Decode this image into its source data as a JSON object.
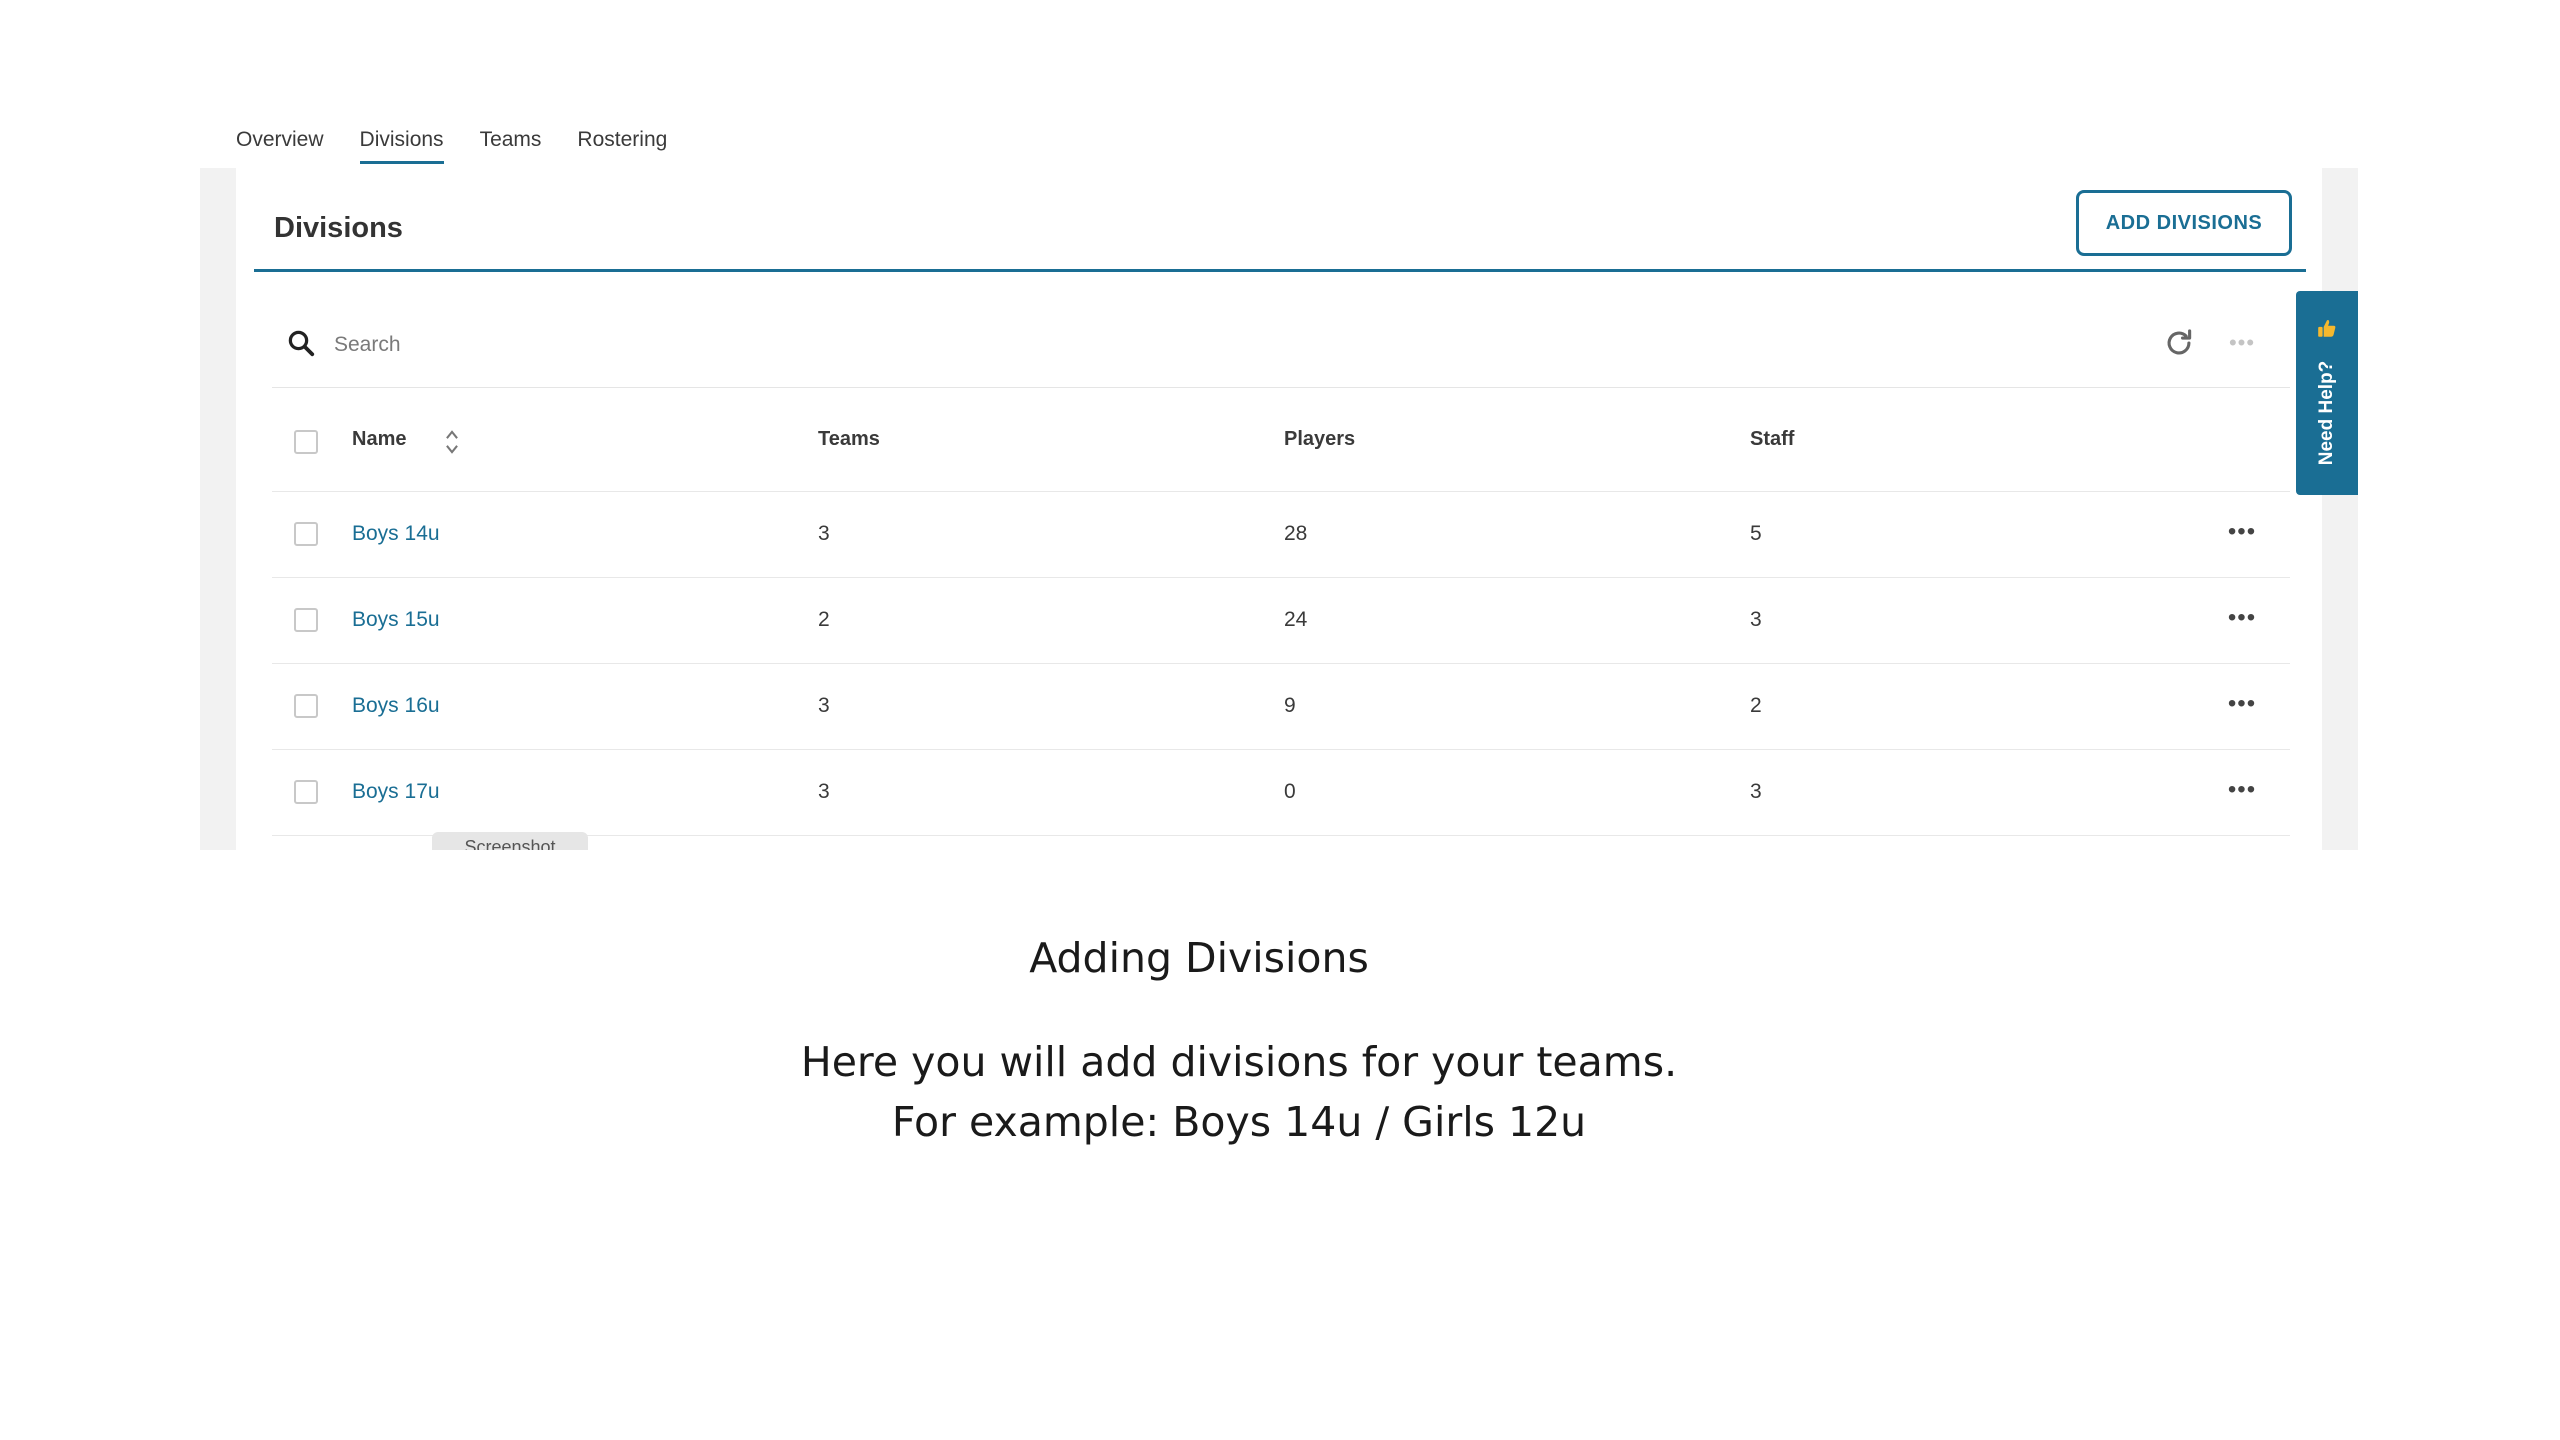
{
  "tabs": [
    {
      "label": "Overview"
    },
    {
      "label": "Divisions"
    },
    {
      "label": "Teams"
    },
    {
      "label": "Rostering"
    }
  ],
  "active_tab": "Divisions",
  "panel": {
    "title": "Divisions",
    "add_button": "ADD DIVISIONS"
  },
  "search": {
    "placeholder": "Search",
    "value": ""
  },
  "table": {
    "headers": {
      "name": "Name",
      "teams": "Teams",
      "players": "Players",
      "staff": "Staff"
    },
    "rows": [
      {
        "name": "Boys 14u",
        "teams": "3",
        "players": "28",
        "staff": "5"
      },
      {
        "name": "Boys 15u",
        "teams": "2",
        "players": "24",
        "staff": "3"
      },
      {
        "name": "Boys 16u",
        "teams": "3",
        "players": "9",
        "staff": "2"
      },
      {
        "name": "Boys 17u",
        "teams": "3",
        "players": "0",
        "staff": "3"
      }
    ]
  },
  "tooltip": "Screenshot",
  "help_tab": "Need Help?",
  "icons": {
    "search": "search-icon",
    "refresh": "refresh-icon",
    "more": "more-horizontal-icon",
    "sort": "sort-icon",
    "help": "thumbs-up-icon"
  },
  "colors": {
    "accent": "#1a6e94",
    "help_tab": "#1a6e94",
    "link": "#1a6e94"
  },
  "caption": {
    "title": "Adding Divisions",
    "line1": "Here you will add divisions for your teams.",
    "line2": "For example: Boys 14u / Girls 12u"
  }
}
